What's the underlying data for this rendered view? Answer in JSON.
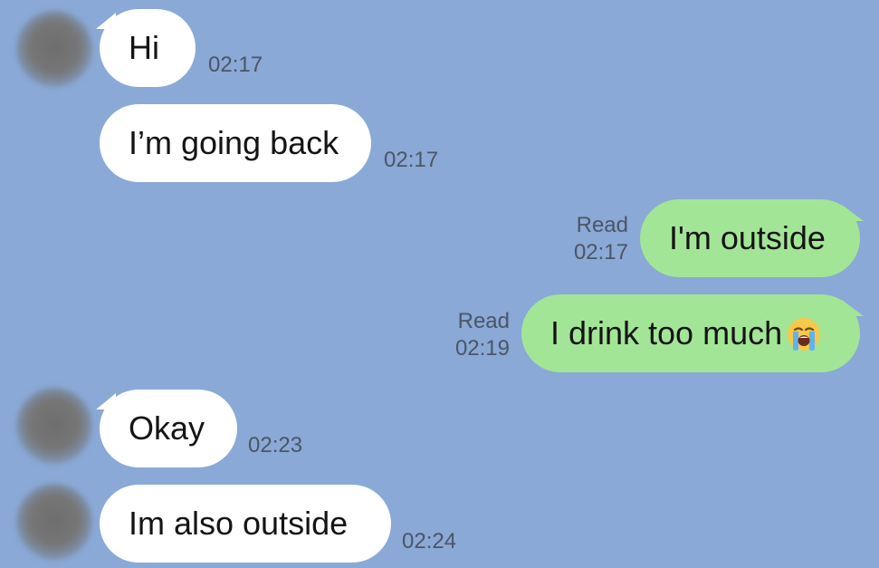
{
  "messages": [
    {
      "direction": "in",
      "text": "Hi",
      "time": "02:17"
    },
    {
      "direction": "in",
      "text": "I’m going back",
      "time": "02:17"
    },
    {
      "direction": "out",
      "text": "I'm outside",
      "status": "Read",
      "time": "02:17"
    },
    {
      "direction": "out",
      "text": "I drink too much",
      "emoji": "loudly-crying-face-icon",
      "status": "Read",
      "time": "02:19"
    },
    {
      "direction": "in",
      "text": "Okay",
      "time": "02:23"
    },
    {
      "direction": "in",
      "text": "Im also outside",
      "time": "02:24"
    }
  ],
  "colors": {
    "background": "#8aa9d6",
    "incoming_bubble": "#ffffff",
    "outgoing_bubble": "#a3e596",
    "meta_text": "#4c5566"
  }
}
